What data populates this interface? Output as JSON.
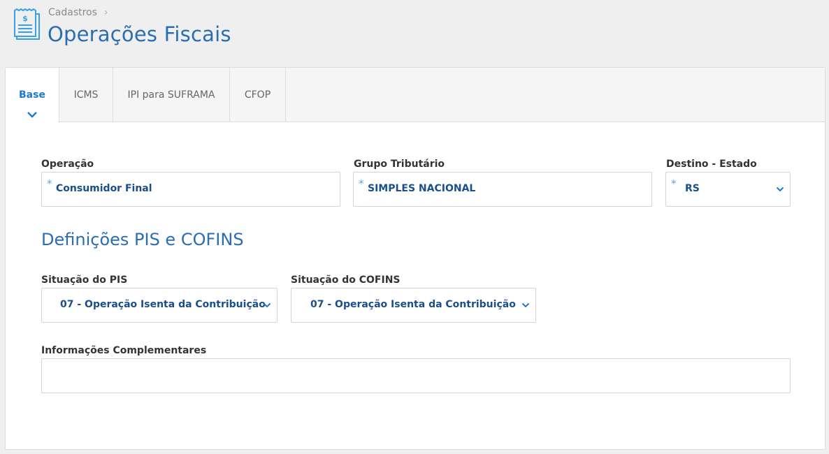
{
  "header": {
    "breadcrumb": "Cadastros",
    "breadcrumb_sep": "›",
    "title": "Operações Fiscais",
    "icon": "receipt-dollar-icon"
  },
  "tabs": [
    {
      "label": "Base",
      "active": true
    },
    {
      "label": "ICMS",
      "active": false
    },
    {
      "label": "IPI para SUFRAMA",
      "active": false
    },
    {
      "label": "CFOP",
      "active": false
    }
  ],
  "form": {
    "operacao": {
      "label": "Operação",
      "value": "Consumidor Final",
      "required_mark": "*"
    },
    "grupo": {
      "label": "Grupo Tributário",
      "value": "SIMPLES NACIONAL",
      "required_mark": "*"
    },
    "destino": {
      "label": "Destino - Estado",
      "value": "RS",
      "required_mark": "*"
    },
    "section_title": "Definições PIS e COFINS",
    "pis": {
      "label": "Situação do PIS",
      "value": "07 - Operação Isenta da Contribuição"
    },
    "cofins": {
      "label": "Situação do COFINS",
      "value": "07 - Operação Isenta da Contribuição"
    },
    "info": {
      "label": "Informações Complementares",
      "value": ""
    }
  },
  "colors": {
    "accent": "#1f78d1",
    "title": "#2a6db3",
    "value_text": "#1a4f8b",
    "required": "#58a6e7"
  }
}
